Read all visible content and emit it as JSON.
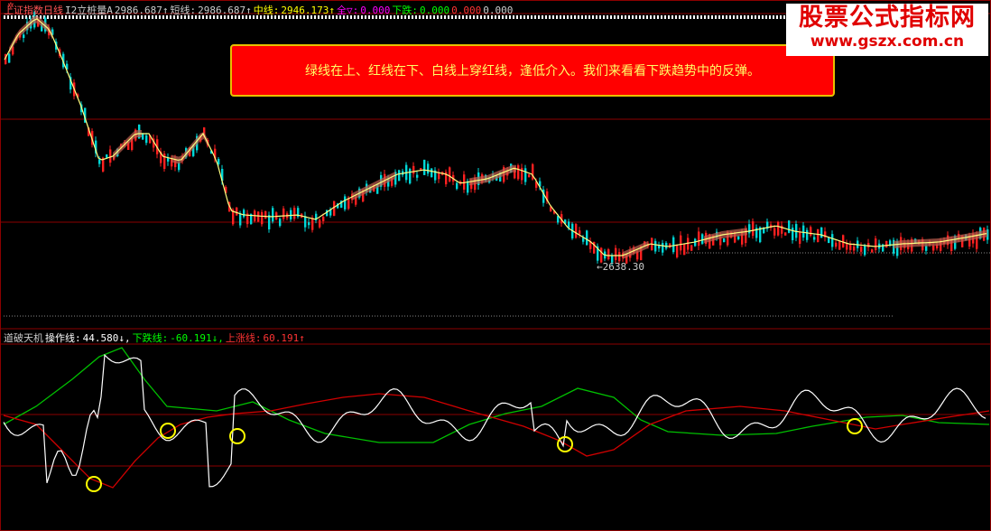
{
  "top_panel": {
    "items": [
      {
        "text": "上证指数日线",
        "color": "#ff5555"
      },
      {
        "text": "I2立桩量A",
        "color": "#cccccc"
      },
      {
        "text": "2986.687↑",
        "color": "#cccccc"
      },
      {
        "text": "短线:",
        "color": "#cccccc"
      },
      {
        "text": "2986.687↑",
        "color": "#cccccc"
      },
      {
        "text": "中线:",
        "color": "#ffff00"
      },
      {
        "text": "2946.173↑",
        "color": "#ffff00"
      },
      {
        "text": "全▽:",
        "color": "#ff00ff"
      },
      {
        "text": "0.000",
        "color": "#ff00ff"
      },
      {
        "text": "下跌:",
        "color": "#00ff00"
      },
      {
        "text": "0.000",
        "color": "#00ff00"
      },
      {
        "text": "0.000",
        "color": "#ff3333"
      },
      {
        "text": "0.000",
        "color": "#cccccc"
      }
    ]
  },
  "callout": {
    "text": "绿线在上、红线在下、白线上穿红线，逢低介入。我们来看看下跌趋势中的反弹。"
  },
  "watermark": {
    "title": "股票公式指标网",
    "url": "www.gszx.com.cn"
  },
  "low_marker": {
    "text": "←2638.30"
  },
  "bottom_panel": {
    "items": [
      {
        "text": "道破天机",
        "color": "#cccccc"
      },
      {
        "text": "操作线:",
        "color": "#ffffff"
      },
      {
        "text": "44.580↓,",
        "color": "#ffffff"
      },
      {
        "text": "下跌线:",
        "color": "#00ff00"
      },
      {
        "text": "-60.191↓,",
        "color": "#00ff00"
      },
      {
        "text": "上涨线:",
        "color": "#ff3333"
      },
      {
        "text": "60.191↑",
        "color": "#ff3333"
      }
    ]
  },
  "colors": {
    "background": "#000000",
    "grid": "#8b0000",
    "up_candle": "#ff2020",
    "down_candle": "#00d8d8",
    "ma_line": "#ffff80",
    "white_line": "#ffffff",
    "green_line": "#00c000",
    "red_line": "#d00000",
    "circle": "#ffff00"
  }
}
